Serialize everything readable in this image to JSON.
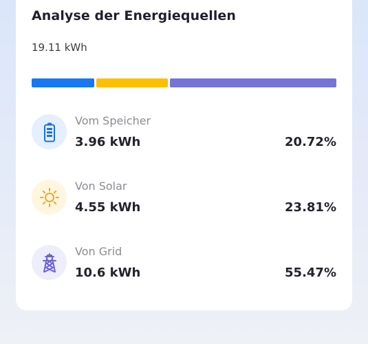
{
  "card": {
    "title": "Analyse der Energiequellen",
    "total": "19.11 kWh"
  },
  "distribution": [
    {
      "name": "speicher",
      "fraction": 0.2072,
      "color": "#1877f2"
    },
    {
      "name": "solar",
      "fraction": 0.2381,
      "color": "#fdbf00"
    },
    {
      "name": "grid",
      "fraction": 0.5547,
      "color": "#7474d8"
    }
  ],
  "sources": [
    {
      "label": "Vom Speicher",
      "value": "3.96 kWh",
      "percent": "20.72%",
      "icon": "battery-icon",
      "icon_color": "#1a6fe0",
      "icon_bg": "#e4efff"
    },
    {
      "label": "Von Solar",
      "value": "4.55 kWh",
      "percent": "23.81%",
      "icon": "sun-icon",
      "icon_color": "#f5a623",
      "icon_bg": "#fff6e0"
    },
    {
      "label": "Von Grid",
      "value": "10.6 kWh",
      "percent": "55.47%",
      "icon": "power-tower-icon",
      "icon_color": "#6b63d6",
      "icon_bg": "#eeedfb"
    }
  ]
}
